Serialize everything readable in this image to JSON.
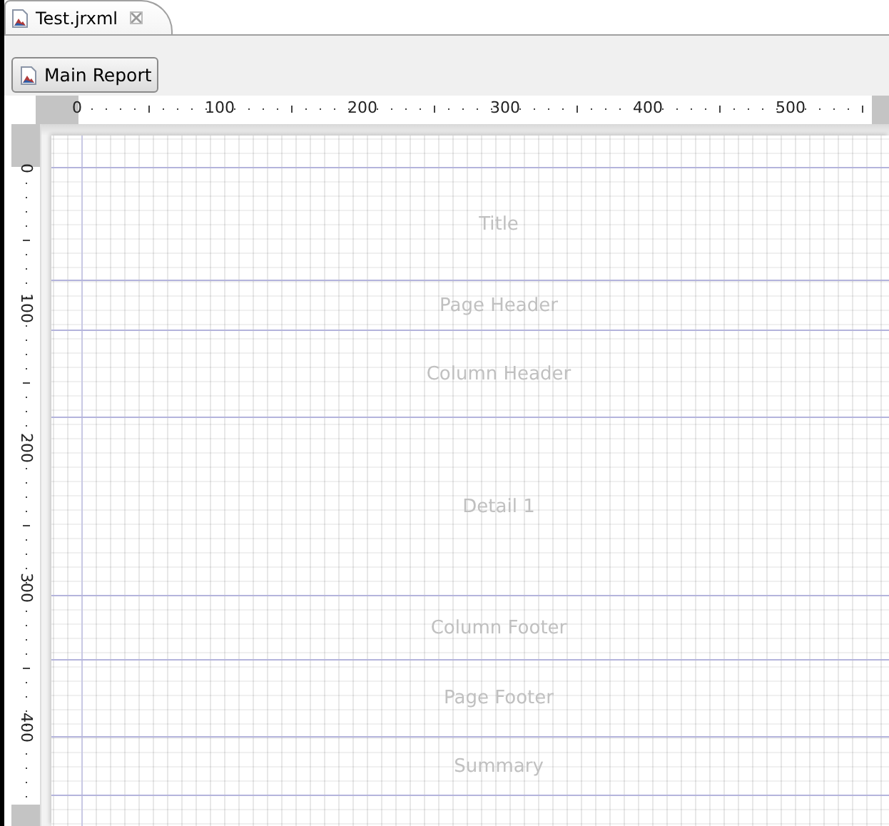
{
  "editor_tab": {
    "label": "Test.jrxml",
    "selected": true
  },
  "toolbar": {
    "button": "Main Report"
  },
  "ruler_horizontal": [
    "0",
    "100",
    "200",
    "300",
    "400",
    "500"
  ],
  "ruler_vertical": [
    "0",
    "100",
    "200",
    "300",
    "400"
  ],
  "bands": [
    {
      "kind": "title",
      "label": "Title"
    },
    {
      "kind": "pageHeader",
      "label": "Page Header"
    },
    {
      "kind": "columnHeader",
      "label": "Column Header"
    },
    {
      "kind": "detail",
      "label": "Detail 1"
    },
    {
      "kind": "columnFooter",
      "label": "Column Footer"
    },
    {
      "kind": "pageFooter",
      "label": "Page Footer"
    },
    {
      "kind": "summary",
      "label": "Summary"
    }
  ]
}
